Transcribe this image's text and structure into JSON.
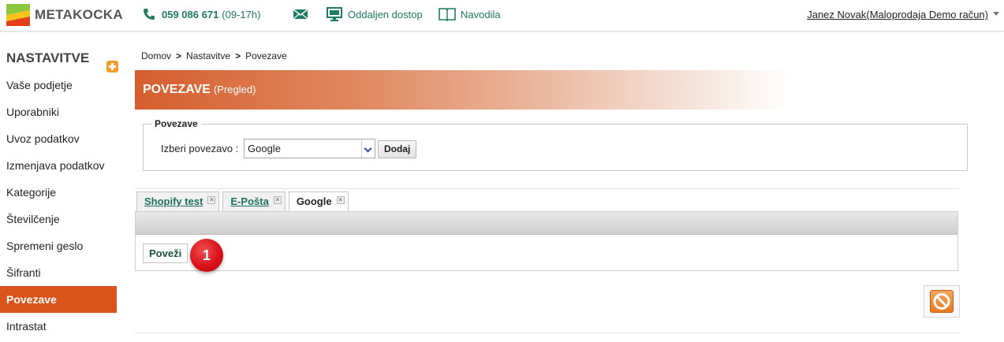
{
  "topbar": {
    "logo_text": "METAKOCKA",
    "phone_number": "059 086 671",
    "phone_hours": "(09-17h)",
    "remote_label": "Oddaljen dostop",
    "guide_label": "Navodila",
    "user_label": "Janez Novak(Maloprodaja Demo račun)"
  },
  "sidebar": {
    "title": "NASTAVITVE",
    "items": [
      {
        "label": "Vaše podjetje"
      },
      {
        "label": "Uporabniki"
      },
      {
        "label": "Uvoz podatkov"
      },
      {
        "label": "Izmenjava podatkov"
      },
      {
        "label": "Kategorije"
      },
      {
        "label": "Številčenje"
      },
      {
        "label": "Spremeni geslo"
      },
      {
        "label": "Šifranti"
      },
      {
        "label": "Povezave",
        "active": true
      },
      {
        "label": "Intrastat"
      }
    ]
  },
  "breadcrumb": {
    "items": [
      "Domov",
      "Nastavitve",
      "Povezave"
    ],
    "separator": ">"
  },
  "header": {
    "title": "POVEZAVE",
    "subtitle": "(Pregled)"
  },
  "connections": {
    "legend": "Povezave",
    "select_label": "Izberi povezavo :",
    "selected_value": "Google",
    "add_button": "Dodaj"
  },
  "tabs": [
    {
      "label": "Shopify test",
      "close": "×"
    },
    {
      "label": "E-Pošta",
      "close": "×"
    },
    {
      "label": "Google",
      "close": "×",
      "active": true
    }
  ],
  "panel": {
    "connect_button": "Poveži",
    "step_number": "1"
  },
  "colors": {
    "accent": "#d9531a",
    "link_green": "#1e7a63",
    "badge_red": "#d9111a"
  }
}
